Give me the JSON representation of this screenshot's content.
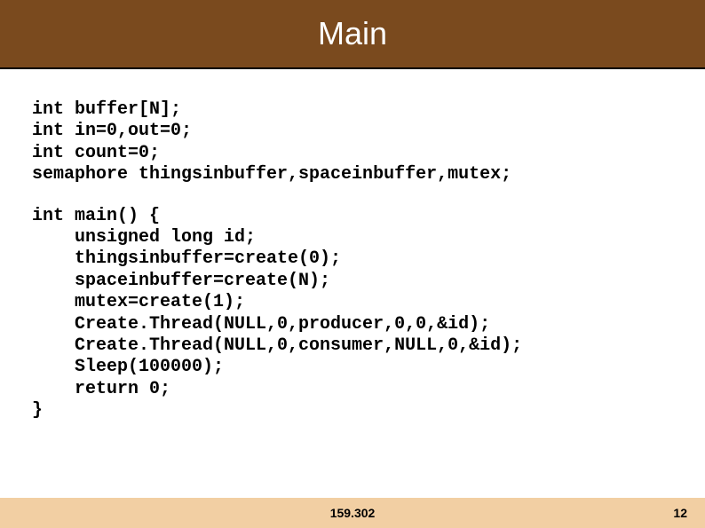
{
  "header": {
    "title": "Main"
  },
  "code": {
    "block1": "int buffer[N];\nint in=0,out=0;\nint count=0;\nsemaphore thingsinbuffer,spaceinbuffer,mutex;",
    "block2": "int main() {\n    unsigned long id;\n    thingsinbuffer=create(0);\n    spaceinbuffer=create(N);\n    mutex=create(1);\n    Create.Thread(NULL,0,producer,0,0,&id);\n    Create.Thread(NULL,0,consumer,NULL,0,&id);\n    Sleep(100000);\n    return 0;\n}"
  },
  "footer": {
    "course": "159.302",
    "page": "12"
  }
}
